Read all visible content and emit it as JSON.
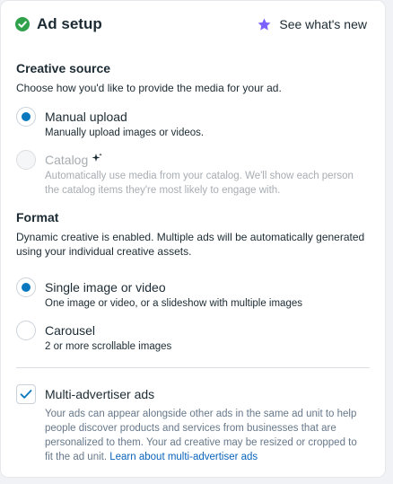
{
  "header": {
    "title": "Ad setup",
    "whats_new_label": "See what's new"
  },
  "creative_source": {
    "title": "Creative source",
    "description": "Choose how you'd like to provide the media for your ad.",
    "options": [
      {
        "label": "Manual upload",
        "sub": "Manually upload images or videos.",
        "selected": true,
        "disabled": false
      },
      {
        "label": "Catalog",
        "sub_line1": "Automatically use media from your catalog. We'll show each person",
        "sub_line2": "the catalog items they're most likely to engage with.",
        "selected": false,
        "disabled": true
      }
    ]
  },
  "format": {
    "title": "Format",
    "description_line1": "Dynamic creative is enabled. Multiple ads will be automatically generated",
    "description_line2": "using your individual creative assets.",
    "options": [
      {
        "label": "Single image or video",
        "sub": "One image or video, or a slideshow with multiple images",
        "selected": true
      },
      {
        "label": "Carousel",
        "sub": "2 or more scrollable images",
        "selected": false
      }
    ]
  },
  "multi_advertiser": {
    "label": "Multi-advertiser ads",
    "checked": true,
    "line1": "Your ads can appear alongside other ads in the same ad unit to help",
    "line2": "people discover products and services from businesses that are",
    "line3": "personalized to them. Your ad creative may be resized or cropped to",
    "line4_prefix": "fit the ad unit.",
    "link": "Learn about multi-advertiser ads"
  },
  "colors": {
    "accent_blue": "#0a78be",
    "success_green": "#31a24c",
    "star_purple": "#7b61ff",
    "link_blue": "#0a63ba"
  }
}
